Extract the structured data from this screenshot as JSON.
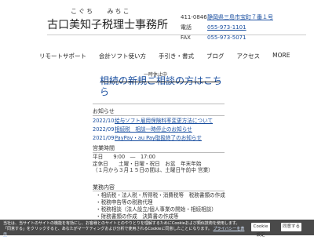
{
  "header": {
    "ruby_left": "こぐち",
    "ruby_right": "みちこ",
    "office_name": "古口美知子税理士事務所",
    "postal_code": "411-0846",
    "address": "静岡県三島市宝町７番１号",
    "tel_label": "電話",
    "tel": "055-973-1101",
    "fax_label": "FAX",
    "fax": "055-973-5071"
  },
  "nav": {
    "items": [
      "リモートサポート",
      "会計ソフト使い方",
      "手引き・書式",
      "ブログ",
      "アクセス",
      "MORE"
    ]
  },
  "notice": {
    "paused": "一時休止中",
    "headline": "相続の新規ご相談の方はこちら"
  },
  "news": {
    "title": "お知らせ",
    "items": [
      {
        "date": "2022/10",
        "text": "給与ソフト雇用保険料率変更方法について"
      },
      {
        "date": "2022/09",
        "text": "相続税　相談一時停止のお知らせ"
      },
      {
        "date": "2021/09",
        "text": "PayPay・au Pay取扱終了のお知らせ"
      }
    ]
  },
  "hours": {
    "title": "営業時間",
    "lines": [
      "平日　　9:00　―　17:00",
      "定休日　　土曜・日曜・祝日　お盆　年末年始",
      "（１月から３月１５日の間は、土曜日午前中 営業）"
    ]
  },
  "services": {
    "title": "業務内容",
    "lines": [
      "・相続税・法人税・所得税・消費税等　税務書類の作成",
      "・税務申告等の税務代理",
      "・税務相談（法人設立/個人事業の開始・相続相談）",
      "・財務書類の作成　決算書の作成等"
    ]
  },
  "cookie": {
    "text": "当社は、当サイトのサイトの機能を有効にし、お客様とのサイトとのやりとりを理解するためにCookieおよび類似技術を使用します。「同意する」をクリックすると、あなたがマーケティングおよび分析で使用されるCookieに同意したことになります。",
    "link_label": "プライバシーを表示",
    "settings_label": "Cookie 設定",
    "accept_label": "同意する"
  }
}
